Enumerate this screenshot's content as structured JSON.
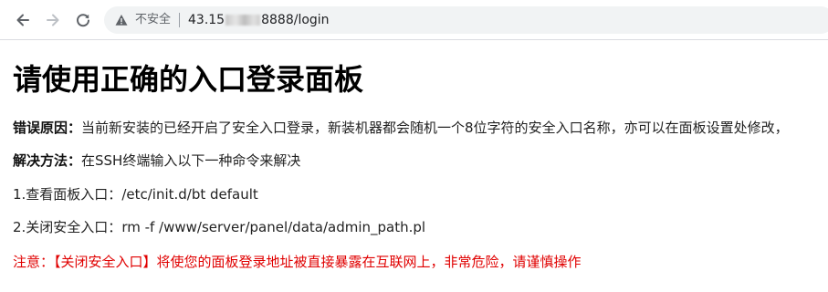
{
  "browser": {
    "security_label": "不安全",
    "url_prefix": "43.15",
    "url_suffix": "8888/login"
  },
  "content": {
    "title": "请使用正确的入口登录面板",
    "error_reason": {
      "label": "错误原因：",
      "text": "当前新安装的已经开启了安全入口登录，新装机器都会随机一个8位字符的安全入口名称，亦可以在面板设置处修改，"
    },
    "solution": {
      "label": "解决方法：",
      "text": "在SSH终端输入以下一种命令来解决"
    },
    "commands": [
      {
        "label": "1.查看面板入口：",
        "command": "/etc/init.d/bt default"
      },
      {
        "label": "2.关闭安全入口：",
        "command": "rm -f /www/server/panel/data/admin_path.pl"
      }
    ],
    "warning": "注意：【关闭安全入口】将使您的面板登录地址被直接暴露在互联网上，非常危险，请谨慎操作"
  },
  "colors": {
    "warning": "#e00000",
    "omnibox_bg": "#f1f3f4"
  }
}
